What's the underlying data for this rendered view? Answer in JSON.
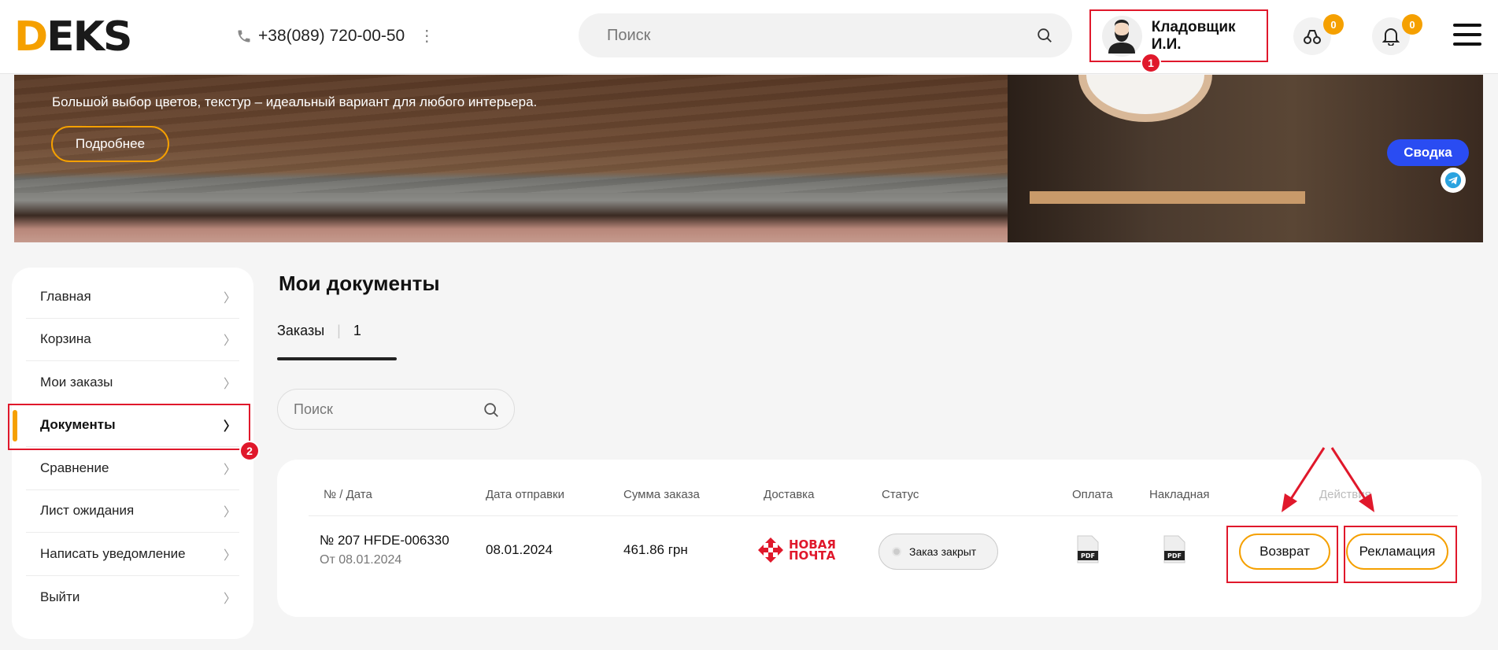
{
  "header": {
    "logo": "DEKS",
    "phone": "+38(089) 720-00-50",
    "search_placeholder": "Поиск",
    "user_name": "Кладовщик И.И.",
    "compare_count": "0",
    "notifications_count": "0"
  },
  "banner": {
    "text": "Большой выбор цветов, текстур – идеальный вариант для любого интерьера.",
    "button": "Подробнее",
    "summary_button": "Сводка"
  },
  "sidebar": {
    "items": [
      {
        "label": "Главная"
      },
      {
        "label": "Корзина"
      },
      {
        "label": "Мои заказы"
      },
      {
        "label": "Документы"
      },
      {
        "label": "Сравнение"
      },
      {
        "label": "Лист ожидания"
      },
      {
        "label": "Написать уведомление"
      },
      {
        "label": "Выйти"
      }
    ],
    "active_index": 3
  },
  "main": {
    "title": "Мои документы",
    "tab_label": "Заказы",
    "tab_count": "1",
    "search_placeholder": "Поиск",
    "columns": [
      "№ / Дата",
      "Дата отправки",
      "Сумма заказа",
      "Доставка",
      "Статус",
      "Оплата",
      "Накладная",
      "Действия"
    ],
    "rows": [
      {
        "number": "№ 207 HFDE-006330",
        "date": "От 08.01.2024",
        "ship_date": "08.01.2024",
        "sum": "461.86 грн",
        "delivery": "НОВАЯ ПОЧТА",
        "status": "Заказ закрыт",
        "payment_file": "PDF",
        "invoice_file": "PDF",
        "action_return": "Возврат",
        "action_claim": "Рекламация"
      }
    ]
  },
  "annotations": {
    "marker_1": "1",
    "marker_2": "2",
    "color": "#e0182b"
  },
  "colors": {
    "accent": "#f5a000",
    "summary": "#2a4cf2",
    "annotation": "#e0182b"
  }
}
